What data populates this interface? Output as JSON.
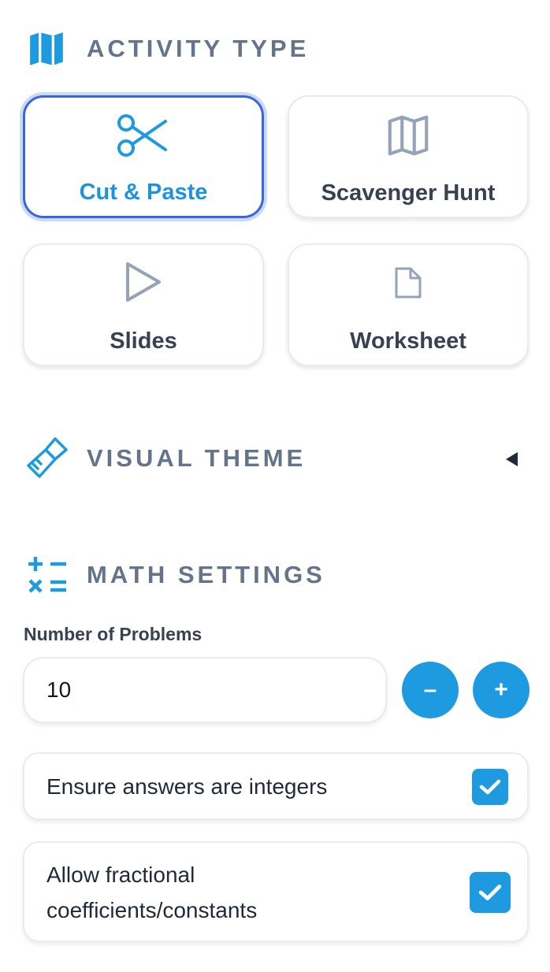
{
  "colors": {
    "accent": "#1e9be0",
    "selected_border": "#3b64e0",
    "muted_icon": "#94a3b8",
    "heading": "#64748b"
  },
  "sections": {
    "activity_type": {
      "title": "ACTIVITY TYPE",
      "icon": "map-icon"
    },
    "visual_theme": {
      "title": "VISUAL THEME",
      "icon": "paintbrush-icon",
      "toggle_icon": "caret-left-icon"
    },
    "math_settings": {
      "title": "MATH SETTINGS",
      "icon": "calculator-symbols-icon"
    }
  },
  "activity_cards": [
    {
      "label": "Cut & Paste",
      "icon": "scissors-icon",
      "selected": true
    },
    {
      "label": "Scavenger Hunt",
      "icon": "map-icon",
      "selected": false
    },
    {
      "label": "Slides",
      "icon": "play-icon",
      "selected": false
    },
    {
      "label": "Worksheet",
      "icon": "document-icon",
      "selected": false
    }
  ],
  "math": {
    "problems_label": "Number of Problems",
    "problems_value": "10",
    "decrement_label": "–",
    "increment_label": "+",
    "options": [
      {
        "label": "Ensure answers are integers",
        "checked": true
      },
      {
        "label_line1": "Allow fractional",
        "label_line2": "coefficients/constants",
        "checked": true
      }
    ]
  }
}
